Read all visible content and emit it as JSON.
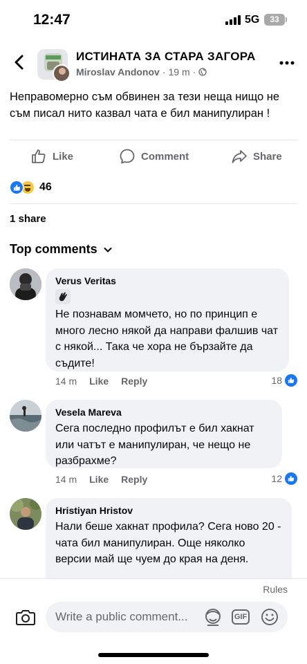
{
  "status_bar": {
    "time": "12:47",
    "network": "5G",
    "battery": "33"
  },
  "header": {
    "group_name": "ИСТИНАТА ЗА СТАРА ЗАГОРА",
    "author": "Miroslav Andonov",
    "time_ago": "19 m",
    "separator": "·",
    "back_icon": "chevron-left-icon",
    "more_icon": "more-horizontal-icon"
  },
  "post": {
    "text": "Неправомерно съм обвинен за тези неща нищо не съм писал нито казвал чата е бил манипулиран !"
  },
  "actions": {
    "like": "Like",
    "comment": "Comment",
    "share": "Share"
  },
  "reactions": {
    "count": "46",
    "types": [
      "like",
      "haha"
    ]
  },
  "shares": "1 share",
  "comments_header": "Top comments",
  "comments": [
    {
      "name": "Verus Veritas",
      "has_wave_emoji": true,
      "text": "Не познавам момчето, но по принцип е много лесно някой да направи фалшив чат с някой... Така че хора не бързайте да съдите!",
      "time": "14 m",
      "like": "Like",
      "reply": "Reply",
      "likes": "18"
    },
    {
      "name": "Vesela Mareva",
      "text": "Сега последно профилът е бил хакнат или чатът е манипулиран, че нещо не разбрахме?",
      "time": "14 m",
      "like": "Like",
      "reply": "Reply",
      "likes": "12"
    },
    {
      "name": "Hristiyan Hristov",
      "text": "Нали беше хакнат профила? Сега ново 20 - чата бил манипулиран. Още няколко версии май ще чуем до края на деня."
    }
  ],
  "composer": {
    "rules": "Rules",
    "placeholder": "Write a public comment...",
    "gif": "GIF"
  },
  "colors": {
    "accent": "#1877f2",
    "secondary_text": "#65676b",
    "bubble": "#f0f2f5"
  }
}
